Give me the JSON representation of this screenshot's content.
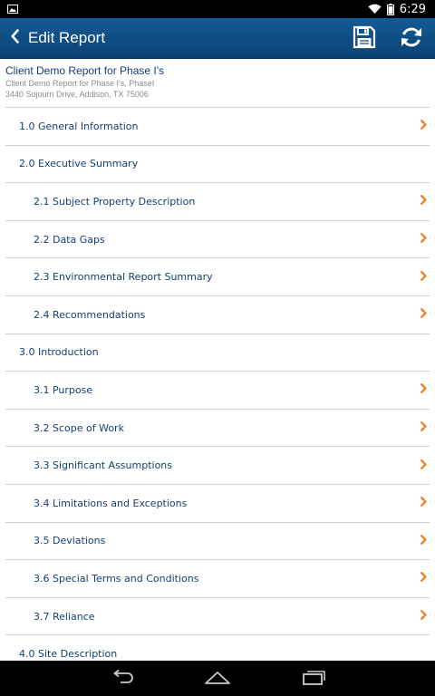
{
  "status_bar": {
    "time": "6:29"
  },
  "action_bar": {
    "title": "Edit Report",
    "icons": [
      "back-chevron-icon",
      "save-icon",
      "refresh-icon"
    ]
  },
  "report": {
    "title": "Client Demo Report for Phase I's",
    "subtitle": "Client Demo Report for Phase I's, PhaseI",
    "address": "3440 Sojourn Drive, Addison, TX 75006"
  },
  "toc": [
    {
      "label": "1.0 General Information",
      "level": 1,
      "chevron": true
    },
    {
      "label": "2.0 Executive Summary",
      "level": 1,
      "chevron": false
    },
    {
      "label": "2.1 Subject Property Description",
      "level": 2,
      "chevron": true
    },
    {
      "label": "2.2 Data Gaps",
      "level": 2,
      "chevron": true
    },
    {
      "label": "2.3 Environmental Report Summary",
      "level": 2,
      "chevron": true
    },
    {
      "label": "2.4 Recommendations",
      "level": 2,
      "chevron": true
    },
    {
      "label": "3.0 Introduction",
      "level": 1,
      "chevron": false
    },
    {
      "label": "3.1 Purpose",
      "level": 2,
      "chevron": true
    },
    {
      "label": "3.2 Scope of Work",
      "level": 2,
      "chevron": true
    },
    {
      "label": "3.3 Significant Assumptions",
      "level": 2,
      "chevron": true
    },
    {
      "label": "3.4 Limitations and Exceptions",
      "level": 2,
      "chevron": true
    },
    {
      "label": "3.5 Deviations",
      "level": 2,
      "chevron": true
    },
    {
      "label": "3.6 Special Terms and Conditions",
      "level": 2,
      "chevron": true
    },
    {
      "label": "3.7 Reliance",
      "level": 2,
      "chevron": true
    },
    {
      "label": "4.0 Site Description",
      "level": 1,
      "chevron": false
    }
  ],
  "colors": {
    "action_bar": "#0b4376",
    "link_text": "#123f72",
    "chevron": "#f07c1c",
    "divider": "#cfcfcf"
  }
}
